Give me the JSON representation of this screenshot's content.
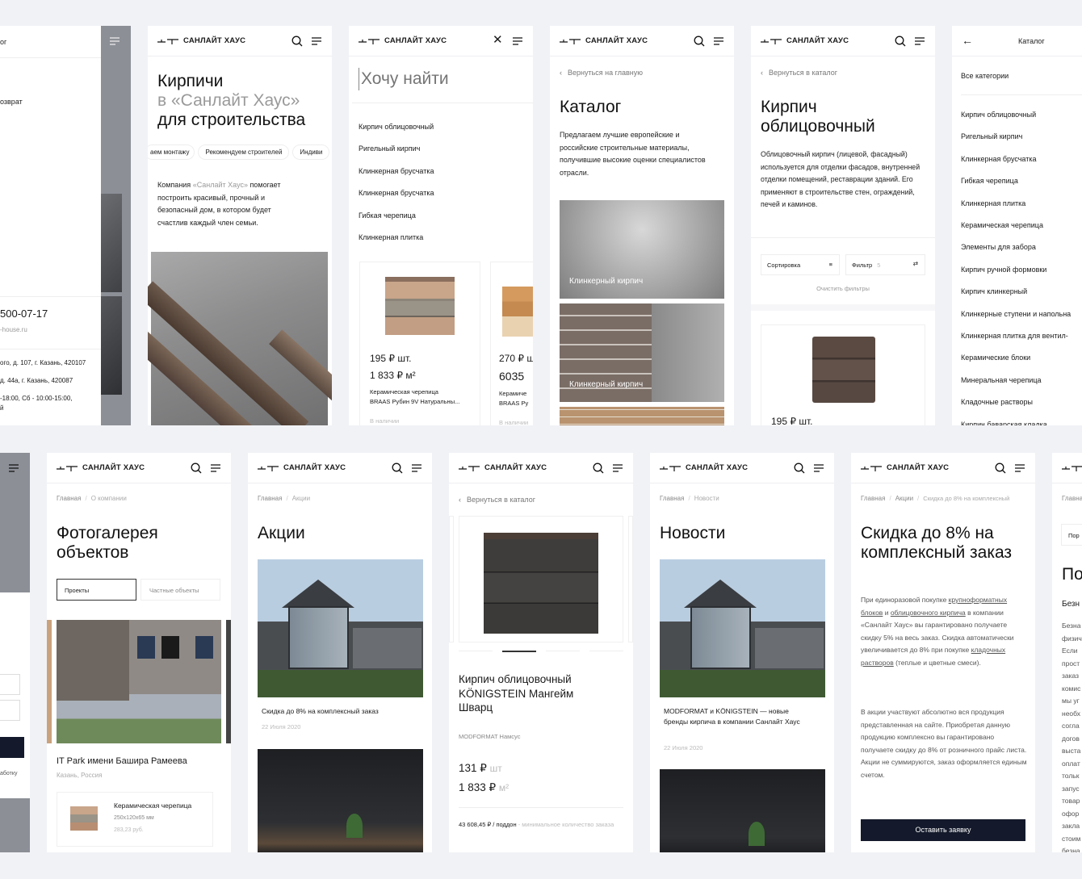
{
  "brand": "САНЛАЙТ ХАУС",
  "contacts_partial": {
    "menu_label": "ог",
    "menu_item": "озврат",
    "phone": "500-07-17",
    "email": "-house.ru",
    "address1": "ого, д. 107, г. Казань, 420107",
    "address2": "д. 44а, г. Казань, 420087",
    "hours1": "-18:00, Сб - 10:00-15:00,",
    "hours2": "й"
  },
  "home": {
    "title_line1": "Кирпичи",
    "title_line2": "в «Санлайт Хаус»",
    "title_line3": "для строительства",
    "chips": [
      "аем монтажу",
      "Рекомендуем строителей",
      "Индиви"
    ],
    "intro_prefix": "Компания ",
    "intro_brand": "«Санлайт Хаус»",
    "intro_rest": " помогает построить красивый, прочный и безопасный дом, в котором будет счастлив каждый член семьи."
  },
  "search": {
    "placeholder": "Хочу найти",
    "suggestions": [
      "Кирпич облицовочный",
      "Ригельный кирпич",
      "Клинкерная брусчатка",
      "Клинкерная брусчатка",
      "Гибкая черепица",
      "Клинкерная плитка"
    ],
    "products": [
      {
        "price": "195 ₽ шт.",
        "price_m2": "1 833 ₽ м²",
        "name1": "Керамическая черепица",
        "name2": "BRAAS Рубин 9V Натуральны...",
        "status": "В наличии"
      },
      {
        "price": "270 ₽ ш",
        "price_m2": "6035",
        "name1": "Керамиче",
        "name2": "BRAAS Ру",
        "status": "В наличии"
      }
    ]
  },
  "catalog": {
    "back": "Вернуться на главную",
    "title": "Каталог",
    "description": "Предлагаем лучшие европейские и российские строительные материалы, получившие высокие оценки специалистов отрасли.",
    "categories": [
      "Клинкерный кирпич",
      "Клинкерный кирпич"
    ]
  },
  "category": {
    "back": "Вернуться в каталог",
    "title": "Кирпич облицовочный",
    "description": "Облицовочный кирпич (лицевой, фасадный) используется для отделки фасадов, внутренней отделки помещений, реставрации зданий. Его применяют в строительстве стен, ограждений, печей и каминов.",
    "sort_label": "Сортировка",
    "filter_label": "Фильтр",
    "filter_count": "5",
    "clear_filters": "Очистить фильтры",
    "product_price": "195 ₽ шт."
  },
  "catalog_menu": {
    "title": "Каталог",
    "all": "Все категории",
    "items": [
      "Кирпич облицовочный",
      "Ригельный кирпич",
      "Клинкерная брусчатка",
      "Гибкая черепица",
      "Клинкерная плитка",
      "Керамическая черепица",
      "Элементы для забора",
      "Кирпич ручной формовки",
      "Кирпич клинкерный",
      "Клинкерные ступени и напольна",
      "Клинкерная плитка для вентил-",
      "Керамические блоки",
      "Минеральная черепица",
      "Кладочные растворы",
      "Кирпич баварская кладка"
    ]
  },
  "form_partial": {
    "consent": "аботку"
  },
  "gallery": {
    "crumbs": [
      "Главная",
      "О компании"
    ],
    "title": "Фотогалерея объектов",
    "tabs": [
      "Проекты",
      "Частные объекты"
    ],
    "project_title": "IT Park имени Башира Рамеева",
    "project_location": "Казань, Россия",
    "product_name": "Керамическая черепица",
    "product_size": "250x120x65 мм",
    "product_price": "283,23 руб."
  },
  "promos": {
    "crumbs": [
      "Главная",
      "Акции"
    ],
    "title": "Акции",
    "item_title": "Скидка до 8% на комплексный заказ",
    "item_date": "22 Июля 2020"
  },
  "product": {
    "back": "Вернуться в каталог",
    "title": "Кирпич облицовочный KÖNIGSTEIN Мангейм Шварц",
    "brand": "MODFORMAT Намсус",
    "price": "131 ₽",
    "unit": "шт",
    "price_m2": "1 833 ₽",
    "unit_m2": "м²",
    "pallet": "43 608,45 ₽ / поддон",
    "min_order": " - минимальное количество заказа"
  },
  "news": {
    "crumbs": [
      "Главная",
      "Новости"
    ],
    "title": "Новости",
    "item_title": "MODFORMAT и KÖNIGSTEIN — новые бренды кирпича в компании Санлайт Хаус",
    "item_date": "22 Июля 2020"
  },
  "promo_detail": {
    "crumbs": [
      "Главная",
      "Акции",
      "Скидка до 8% на комплексный"
    ],
    "title": "Скидка до 8% на комплексный заказ",
    "p1_a": "При единоразовой покупке ",
    "p1_link1": "крупноформатных блоков",
    "p1_b": " и ",
    "p1_link2": "облицовочного кирпича",
    "p1_c": " в компании «Санлайт Хаус» вы гарантировано получаете скидку 5% на весь заказ. Скидка автоматически увеличивается до 8% при покупке ",
    "p1_link3": "кладочных растворов",
    "p1_d": " (теплые и цветные смеси).",
    "p2": "В акции участвуют абсолютно вся продукция представленная на сайте. Приобретая данную продукцию комплексно вы гарантировано получаете скидку до 8% от розничного прайс листа. Акции не суммируются, заказ оформляется единым счетом.",
    "cta": "Оставить заявку"
  },
  "payment_partial": {
    "crumb": "Главна",
    "button": "Пор",
    "title": "По",
    "subtitle": "Безн",
    "lines": [
      "Безна",
      "физич",
      "Если",
      "прост",
      "заказ",
      "комис",
      "мы уг",
      "необх",
      "согла",
      "догов",
      "выста",
      "оплат",
      "тольк",
      "запус",
      "товар",
      "офор",
      "закла",
      "стоим",
      "безна"
    ]
  },
  "colors": {
    "background": "#f1f2f6",
    "dark_button": "#141a2b",
    "side_gray": "#8c8f96"
  }
}
